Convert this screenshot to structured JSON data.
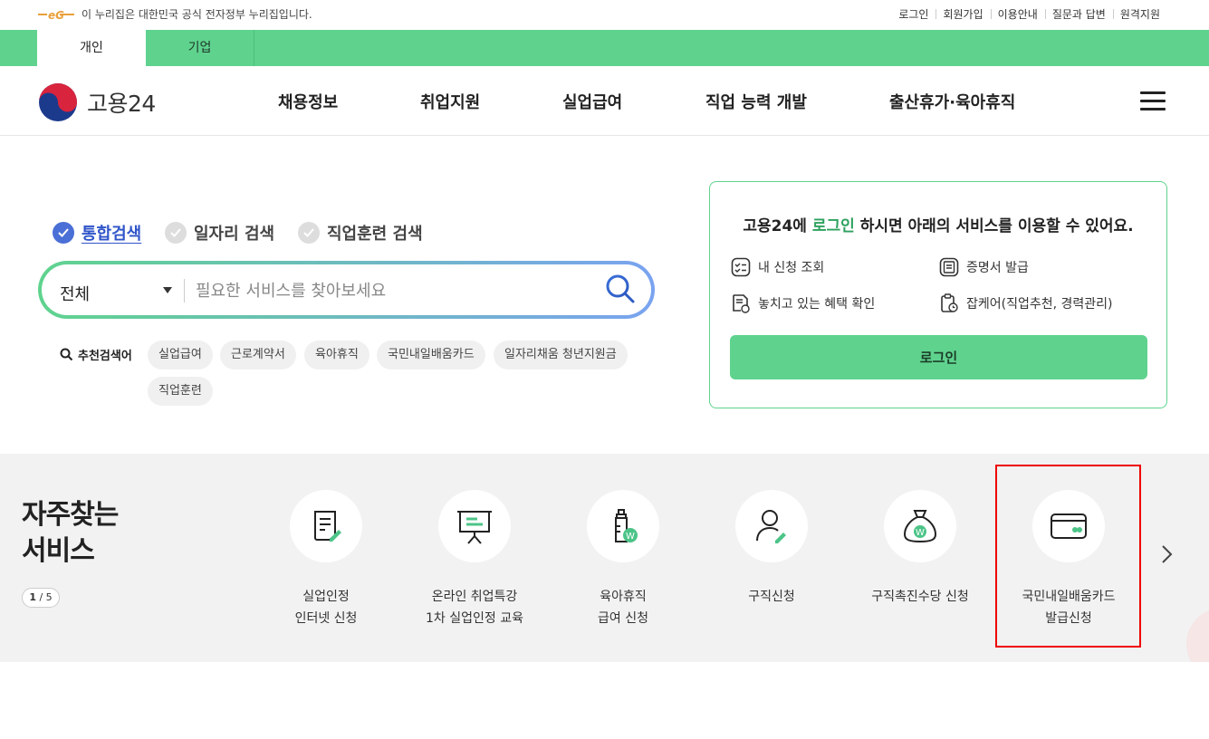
{
  "util": {
    "gov_notice": "이 누리집은 대한민국 공식 전자정부 누리집입니다.",
    "links": [
      "로그인",
      "회원가입",
      "이용안내",
      "질문과 답변",
      "원격지원"
    ]
  },
  "tabs": [
    "개인",
    "기업"
  ],
  "header": {
    "logo_text": "고용24",
    "nav": [
      "채용정보",
      "취업지원",
      "실업급여",
      "직업 능력 개발",
      "출산휴가·육아휴직"
    ]
  },
  "search": {
    "scopes": [
      "통합검색",
      "일자리 검색",
      "직업훈련 검색"
    ],
    "active_scope": "통합검색",
    "category": "전체",
    "placeholder": "필요한 서비스를 찾아보세요",
    "reco_label": "추천검색어",
    "keywords": [
      "실업급여",
      "근로계약서",
      "육아휴직",
      "국민내일배움카드",
      "일자리채움 청년지원금",
      "직업훈련"
    ]
  },
  "login_panel": {
    "title_pre": "고용24에 ",
    "title_link": "로그인",
    "title_post": " 하시면 아래의 서비스를 이용할 수 있어요.",
    "services": [
      "내 신청 조회",
      "증명서 발급",
      "놓치고 있는 혜택 확인",
      "잡케어(직업추천, 경력관리)"
    ],
    "button": "로그인"
  },
  "freq": {
    "title_line1": "자주찾는",
    "title_line2": "서비스",
    "page_current": "1",
    "page_total": " / 5",
    "items": [
      {
        "line1": "실업인정",
        "line2": "인터넷 신청",
        "icon": "document-pen-icon"
      },
      {
        "line1": "온라인 취업특강",
        "line2": "1차 실업인정 교육",
        "icon": "presentation-board-icon"
      },
      {
        "line1": "육아휴직",
        "line2": "급여 신청",
        "icon": "baby-bottle-won-icon"
      },
      {
        "line1": "구직신청",
        "line2": "",
        "icon": "person-pen-icon"
      },
      {
        "line1": "구직촉진수당 신청",
        "line2": "",
        "icon": "money-bag-won-icon"
      },
      {
        "line1": "국민내일배움카드",
        "line2": "발급신청",
        "icon": "card-icon"
      }
    ]
  },
  "colors": {
    "brand_green": "#5fd38e",
    "accent_blue": "#4a6fd6",
    "highlight_red": "#e00000"
  }
}
